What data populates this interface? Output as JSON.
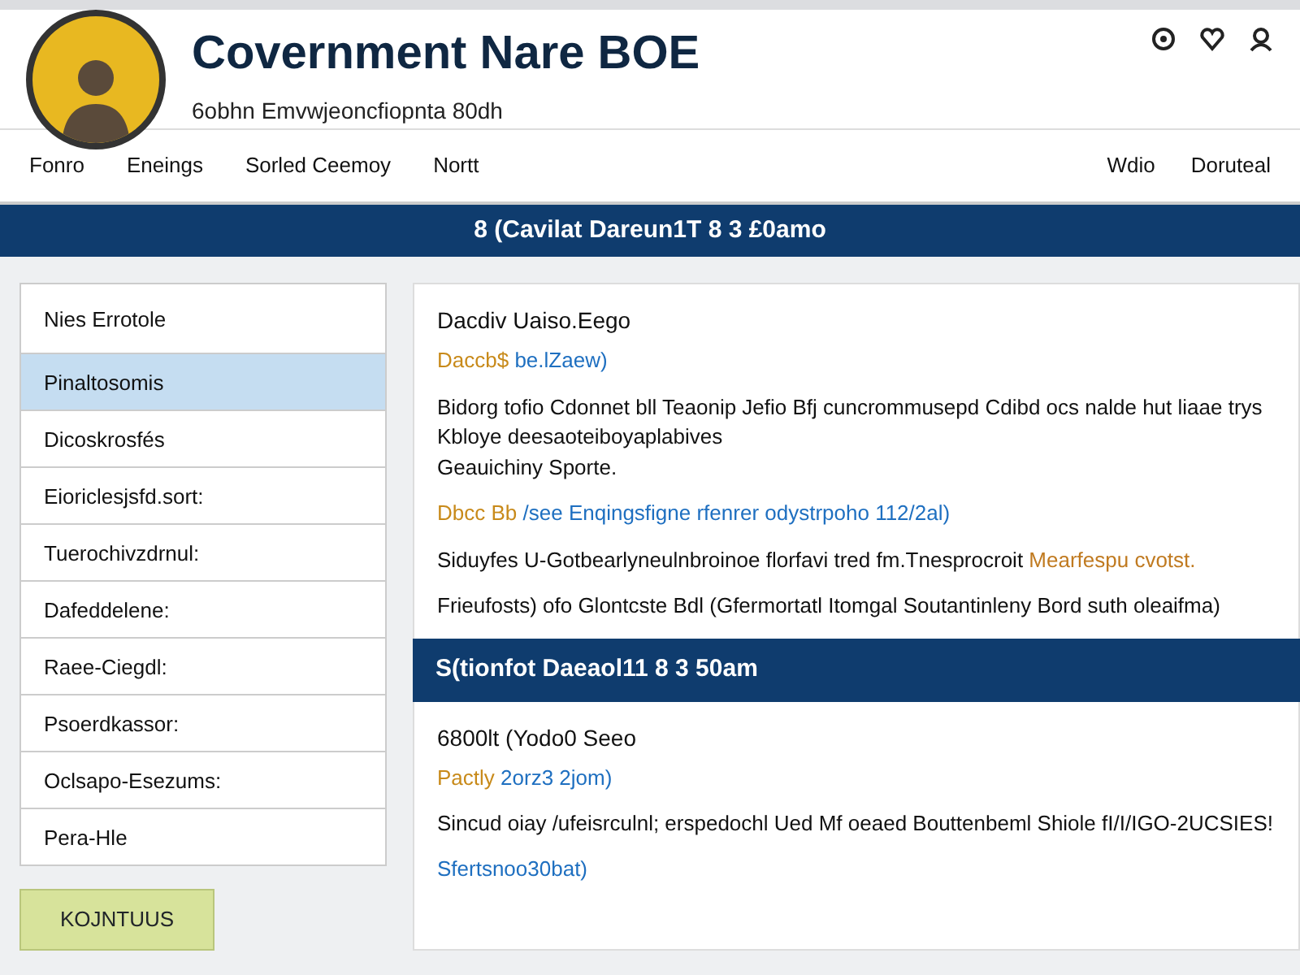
{
  "header": {
    "title": "Covernment Nare BOE",
    "subtitle": "6obhn Emvwjeoncfiopnta 80dh"
  },
  "nav": {
    "left": [
      "Fonro",
      "Eneings",
      "Sorled Ceemoy",
      "Nortt"
    ],
    "right": [
      "Wdio",
      "Doruteal"
    ]
  },
  "banner": "8 (Cavilat Dareun1T 8 3 £0amo",
  "sidebar": {
    "title": "Nies Errotole",
    "items": [
      {
        "label": "Pinaltosomis",
        "selected": true
      },
      {
        "label": "Dicoskrosfés",
        "selected": false
      },
      {
        "label": "Eioriclesjsfd.sort:",
        "selected": false
      },
      {
        "label": "Tuerochivzdrnul:",
        "selected": false
      },
      {
        "label": "Dafeddelene:",
        "selected": false
      },
      {
        "label": "Raee-Ciegdl:",
        "selected": false
      },
      {
        "label": "Psoerdkassor:",
        "selected": false
      },
      {
        "label": "Oclsapo-Esezums:",
        "selected": false
      },
      {
        "label": "Pera-Hle",
        "selected": false
      }
    ],
    "button": "KOJNTUUS"
  },
  "sections": [
    {
      "title": "Dacdiv Uaiso.Eego",
      "date": {
        "label": "Daccb$",
        "value": "be.lZaew)"
      },
      "paragraphs": [
        "Bidorg tofio Cdonnet bll Teaonip Jefio Bfj cuncrommusepd Cdibd ocs nalde hut liaae trys Kbloye deesaoteiboyaplabives",
        "Geauichiny Sporte."
      ],
      "date2": {
        "label": "Dbcc Bb",
        "value": "/see Enqingsfigne rfenrer odystrpoho 112/2al)"
      },
      "notes": [
        "Siduyfes U-Gotbearlyneulnbroinoe florfavi tred fm.Tnesprocroit **Mearfespu cvotst.**",
        "Frieufosts) ofo Glontcste Bdl (Gfermortatl Itomgal Soutantinleny Bord suth oleaifma)"
      ]
    },
    {
      "heading": "S(tionfot Daeaol11 8 3 50am",
      "title": "6800lt (Yodo0 Seeo",
      "date": {
        "label": "Pactly",
        "value": "2orz3 2jom)"
      },
      "paragraphs": [
        "Sincud oiay /ufeisrculnl; erspedochl Ued Mf oeaed Bouttenbeml Shiole fI/I/IGO-2UCSIES!"
      ],
      "link": "Sfertsnoo30bat)"
    }
  ]
}
